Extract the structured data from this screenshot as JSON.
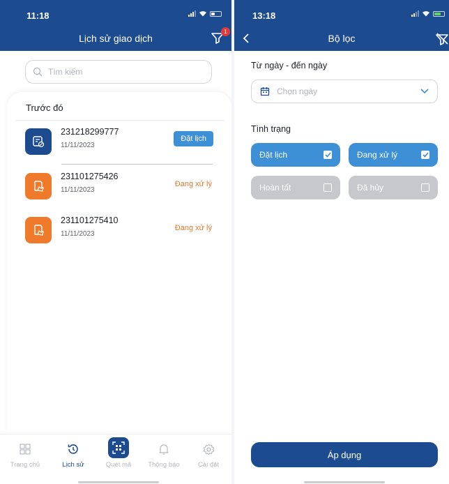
{
  "history": {
    "status_time": "11:18",
    "title": "Lịch sử giao dịch",
    "filter_badge": "1",
    "search_placeholder": "Tìm kiếm",
    "section_title": "Trước đó",
    "transactions": [
      {
        "code": "231218299777",
        "date": "11/11/2023",
        "status": "Đặt lịch",
        "status_style": "button",
        "icon_color": "#1d4b8f"
      },
      {
        "code": "231101275426",
        "date": "11/11/2023",
        "status": "Đang xử lý",
        "status_style": "text",
        "icon_color": "#f07a2c"
      },
      {
        "code": "231101275410",
        "date": "11/11/2023",
        "status": "Đang xử lý",
        "status_style": "text",
        "icon_color": "#f07a2c"
      }
    ],
    "nav": [
      {
        "label": "Trang chủ",
        "icon": "home-grid-icon",
        "active": false
      },
      {
        "label": "Lịch sử",
        "icon": "history-clock-icon",
        "active": true
      },
      {
        "label": "Quét mã",
        "icon": "qr-scan-icon",
        "active": false
      },
      {
        "label": "Thông báo",
        "icon": "bell-icon",
        "active": false
      },
      {
        "label": "Cài đặt",
        "icon": "gear-icon",
        "active": false
      }
    ]
  },
  "filter": {
    "status_time": "13:18",
    "title": "Bộ lọc",
    "date_range_label": "Từ ngày - đến ngày",
    "date_placeholder": "Chọn ngày",
    "status_label": "Tình trạng",
    "statuses": [
      {
        "label": "Đặt lịch",
        "checked": true
      },
      {
        "label": "Đang xử lý",
        "checked": true
      },
      {
        "label": "Hoàn tất",
        "checked": false
      },
      {
        "label": "Đã hủy",
        "checked": false
      }
    ],
    "apply_label": "Áp dụng"
  },
  "colors": {
    "primary": "#1d4b8f",
    "accent_blue": "#3e90d6",
    "processing_orange": "#e9782c",
    "chip_off": "#c6c8cc"
  }
}
